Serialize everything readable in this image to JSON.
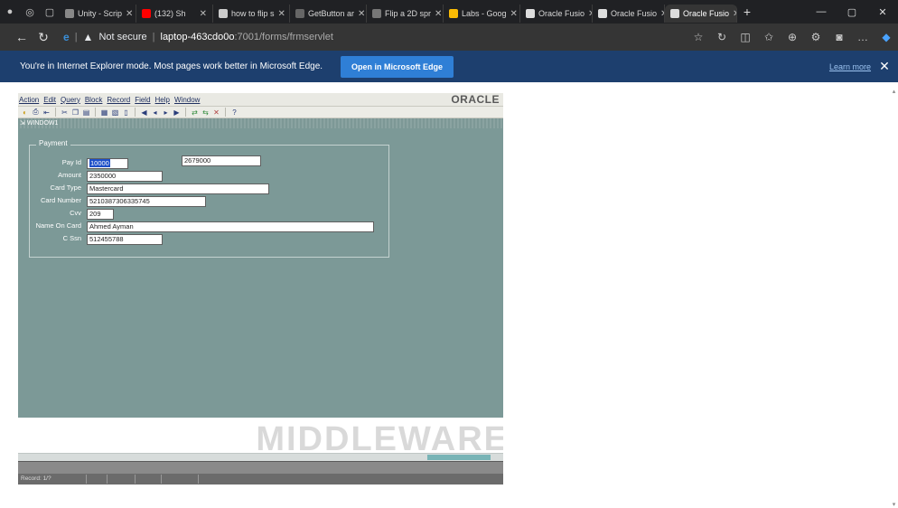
{
  "browser": {
    "tabs": [
      {
        "label": "Unity - Scrip",
        "favicon_color": "#888888"
      },
      {
        "label": "(132) Sh",
        "favicon_color": "#ff0000"
      },
      {
        "label": "how to flip s",
        "favicon_color": "#cccccc"
      },
      {
        "label": "GetButton ar",
        "favicon_color": "#666666"
      },
      {
        "label": "Flip a 2D spr",
        "favicon_color": "#777777"
      },
      {
        "label": "Labs - Goog",
        "favicon_color": "#fbbc04"
      },
      {
        "label": "Oracle Fusio",
        "favicon_color": "#dddddd"
      },
      {
        "label": "Oracle Fusio",
        "favicon_color": "#dddddd"
      },
      {
        "label": "Oracle Fusio",
        "favicon_color": "#dddddd",
        "active": true
      }
    ],
    "new_tab": "+",
    "address": {
      "security": "Not secure",
      "host": "laptop-463cdo0o",
      "path": ":7001/forms/frmservlet"
    },
    "ie_mode": {
      "message": "You're in Internet Explorer mode. Most pages work better in Microsoft Edge.",
      "button": "Open in Microsoft Edge",
      "learn_more": "Learn more"
    }
  },
  "oracle_forms": {
    "menu": [
      "Action",
      "Edit",
      "Query",
      "Block",
      "Record",
      "Field",
      "Help",
      "Window"
    ],
    "logo": "ORACLE",
    "window_title": "WINDOW1",
    "frame_title": "Payment",
    "fields": {
      "pay_id": {
        "label": "Pay Id",
        "value": "10000"
      },
      "extra": {
        "value": "2679000"
      },
      "amount": {
        "label": "Amount",
        "value": "2350000"
      },
      "card_type": {
        "label": "Card Type",
        "value": "Mastercard"
      },
      "card_number": {
        "label": "Card Number",
        "value": "5210387306335745"
      },
      "cvv": {
        "label": "Cvv",
        "value": "209"
      },
      "name_on_card": {
        "label": "Name On Card",
        "value": "Ahmed Ayman"
      },
      "c_ssn": {
        "label": "C Ssn",
        "value": "512455788"
      }
    },
    "watermark": "MIDDLEWARE",
    "status": "Record: 1/?",
    "help_icon": "?"
  },
  "colors": {
    "tabbar": "#202124",
    "ie_bar": "#1d3f6e",
    "canvas": "#7c9997",
    "accent": "#2f7fd6"
  }
}
